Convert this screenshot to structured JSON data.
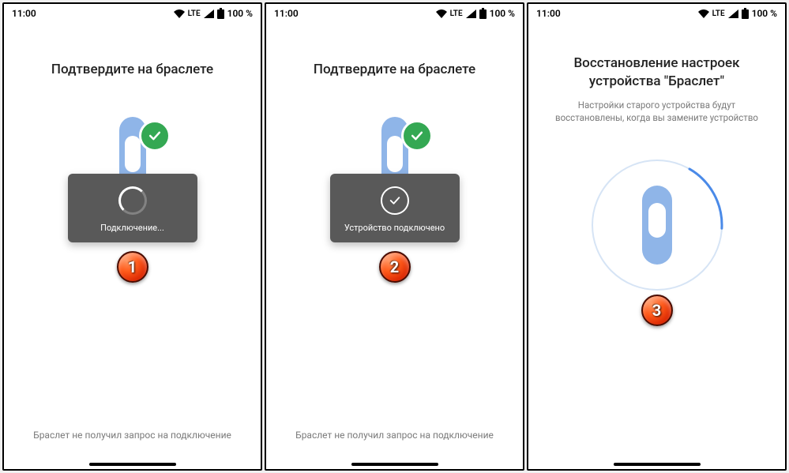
{
  "statusbar": {
    "time": "11:00",
    "network": "LTE",
    "signal_icon": "signal-icon",
    "battery_icon": "battery-icon",
    "battery_text": "100 %",
    "wifi_icon": "wifi-icon"
  },
  "screens": [
    {
      "title": "Подтвердите на браслете",
      "toast_text": "Подключение...",
      "footer": "Браслет не получил запрос на подключение",
      "marker": "1"
    },
    {
      "title": "Подтвердите на браслете",
      "toast_text": "Устройство подключено",
      "footer": "Браслет не получил запрос на подключение",
      "marker": "2"
    },
    {
      "title": "Восстановление настроек устройства \"Браслет\"",
      "subtitle": "Настройки старого устройства будут восстановлены, когда вы замените устройство",
      "marker": "3"
    }
  ],
  "colors": {
    "accent_green": "#34a853",
    "band_blue": "#8fb5e8",
    "toast_bg": "#595959",
    "marker_orange": "#ff5a1a"
  }
}
